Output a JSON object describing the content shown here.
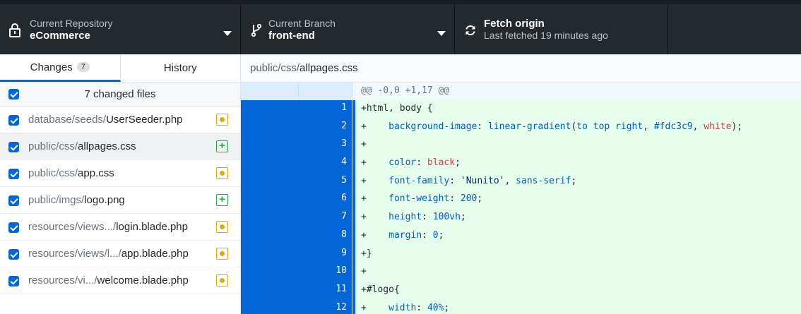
{
  "toolbar": {
    "repo": {
      "label": "Current Repository",
      "value": "eCommerce"
    },
    "branch": {
      "label": "Current Branch",
      "value": "front-end"
    },
    "fetch": {
      "label": "Fetch origin",
      "value": "Last fetched 19 minutes ago"
    }
  },
  "sidebar": {
    "tabs": {
      "changes": "Changes",
      "changes_count": "7",
      "history": "History"
    },
    "summary": "7 changed files",
    "files": [
      {
        "dir": "database/seeds/",
        "name": "UserSeeder.php",
        "status": "modified"
      },
      {
        "dir": "public/css/",
        "name": "allpages.css",
        "status": "added"
      },
      {
        "dir": "public/css/",
        "name": "app.css",
        "status": "modified"
      },
      {
        "dir": "public/imgs/",
        "name": "logo.png",
        "status": "added"
      },
      {
        "dir": "resources/views.../",
        "name": "login.blade.php",
        "status": "modified"
      },
      {
        "dir": "resources/views/l.../",
        "name": "app.blade.php",
        "status": "modified"
      },
      {
        "dir": "resources/vi.../",
        "name": "welcome.blade.php",
        "status": "modified"
      }
    ]
  },
  "diff": {
    "path_dir": "public/css/",
    "path_name": "allpages.css",
    "hunk": "@@ -0,0 +1,17 @@",
    "lines": [
      {
        "n": "1",
        "text": "+html, body {"
      },
      {
        "n": "2",
        "text": "+    background-image: linear-gradient(to top right, #fdc3c9, white);"
      },
      {
        "n": "3",
        "text": "+"
      },
      {
        "n": "4",
        "text": "+    color: black;"
      },
      {
        "n": "5",
        "text": "+    font-family: 'Nunito', sans-serif;"
      },
      {
        "n": "6",
        "text": "+    font-weight: 200;"
      },
      {
        "n": "7",
        "text": "+    height: 100vh;"
      },
      {
        "n": "8",
        "text": "+    margin: 0;"
      },
      {
        "n": "9",
        "text": "+}"
      },
      {
        "n": "10",
        "text": "+"
      },
      {
        "n": "11",
        "text": "+#logo{"
      },
      {
        "n": "12",
        "text": "+    width: 40%;"
      }
    ]
  },
  "colors": {
    "accent": "#0366d6",
    "added_bg": "#e6ffed",
    "modified": "#dbab09",
    "added": "#28a745"
  }
}
